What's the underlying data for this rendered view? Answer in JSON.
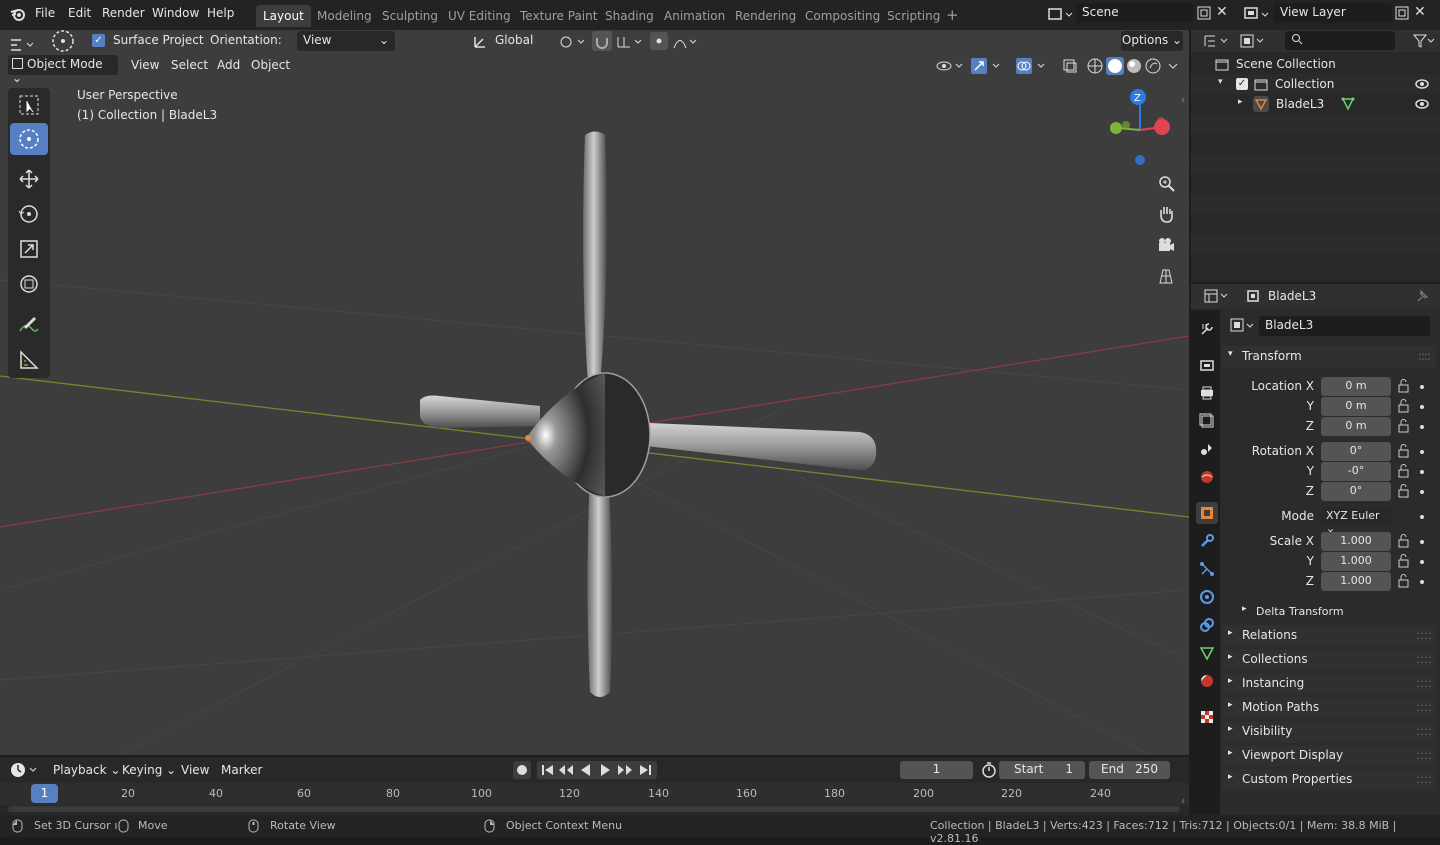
{
  "menu": {
    "items": [
      "File",
      "Edit",
      "Render",
      "Window",
      "Help"
    ]
  },
  "workspaces": [
    {
      "label": "Layout",
      "active": true
    },
    {
      "label": "Modeling"
    },
    {
      "label": "Sculpting"
    },
    {
      "label": "UV Editing"
    },
    {
      "label": "Texture Paint"
    },
    {
      "label": "Shading"
    },
    {
      "label": "Animation"
    },
    {
      "label": "Rendering"
    },
    {
      "label": "Compositing"
    },
    {
      "label": "Scripting"
    }
  ],
  "scene": {
    "name": "Scene"
  },
  "view_layer": {
    "name": "View Layer"
  },
  "tool_header": {
    "surface_project": "Surface Project",
    "orientation_label": "Orientation:",
    "orientation_value": "View",
    "transform_orientation": "Global",
    "options": "Options"
  },
  "viewport_header": {
    "mode": "Object Mode",
    "view": "View",
    "select": "Select",
    "add": "Add",
    "object": "Object"
  },
  "viewport": {
    "perspective": "User Perspective",
    "collection_info": "(1) Collection | BladeL3",
    "gizmo_z": "Z"
  },
  "outliner": {
    "search_placeholder": "",
    "scene_collection": "Scene Collection",
    "collection": "Collection",
    "object": "BladeL3"
  },
  "properties": {
    "object_name": "BladeL3",
    "datablock": "BladeL3",
    "transform": "Transform",
    "location_x_label": "Location X",
    "y_label": "Y",
    "z_label": "Z",
    "rotation_x_label": "Rotation X",
    "mode_label": "Mode",
    "scale_x_label": "Scale X",
    "location": [
      "0 m",
      "0 m",
      "0 m"
    ],
    "rotation": [
      "0°",
      "-0°",
      "0°"
    ],
    "rotation_mode": "XYZ Euler",
    "scale": [
      "1.000",
      "1.000",
      "1.000"
    ],
    "delta_transform": "Delta Transform",
    "panels": [
      "Relations",
      "Collections",
      "Instancing",
      "Motion Paths",
      "Visibility",
      "Viewport Display",
      "Custom Properties"
    ]
  },
  "timeline": {
    "playback": "Playback",
    "keying": "Keying",
    "view": "View",
    "marker": "Marker",
    "current_frame": "1",
    "start_label": "Start",
    "start": "1",
    "end_label": "End",
    "end": "250",
    "ruler": [
      "1",
      "20",
      "40",
      "60",
      "80",
      "100",
      "120",
      "140",
      "160",
      "180",
      "200",
      "220",
      "240"
    ]
  },
  "statusbar": {
    "set_cursor": "Set 3D Cursor",
    "move": "Move",
    "rotate": "Rotate View",
    "context_menu": "Object Context Menu",
    "stats": "Collection | BladeL3 | Verts:423 | Faces:712 | Tris:712 | Objects:0/1 | Mem: 38.8 MiB | v2.81.16"
  },
  "colors": {
    "accent": "#5680c2",
    "active_object": "#e5863a",
    "x_axis": "#e0444e",
    "y_axis": "#7fb536",
    "z_axis": "#2d7ae3"
  }
}
